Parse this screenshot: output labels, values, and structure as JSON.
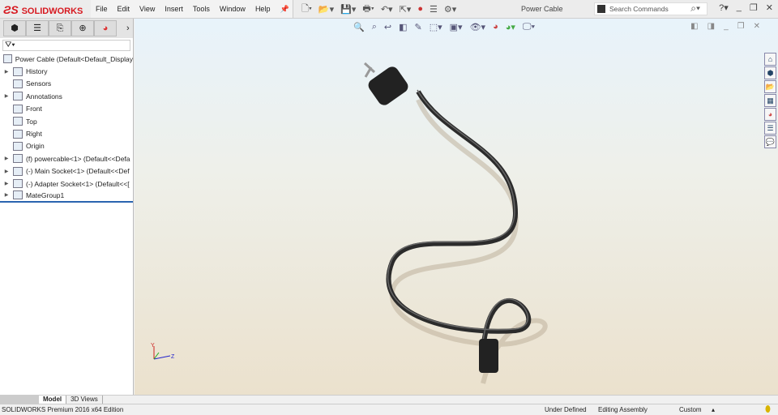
{
  "app": {
    "logo": "SOLIDWORKS",
    "title": "Power Cable"
  },
  "menu": [
    "File",
    "Edit",
    "View",
    "Insert",
    "Tools",
    "Window",
    "Help"
  ],
  "search": {
    "placeholder": "Search Commands"
  },
  "tree": {
    "root": "Power Cable  (Default<Default_Display",
    "items": [
      {
        "label": "History",
        "arrow": true,
        "icon": "history-folder-icon"
      },
      {
        "label": "Sensors",
        "arrow": false,
        "icon": "sensors-folder-icon"
      },
      {
        "label": "Annotations",
        "arrow": true,
        "icon": "annotations-folder-icon"
      },
      {
        "label": "Front",
        "arrow": false,
        "icon": "plane-icon"
      },
      {
        "label": "Top",
        "arrow": false,
        "icon": "plane-icon"
      },
      {
        "label": "Right",
        "arrow": false,
        "icon": "plane-icon"
      },
      {
        "label": "Origin",
        "arrow": false,
        "icon": "origin-icon"
      },
      {
        "label": "(f) powercable<1> (Default<<Defa",
        "arrow": true,
        "icon": "part-icon"
      },
      {
        "label": "(-) Main Socket<1> (Default<<Def",
        "arrow": true,
        "icon": "part-icon"
      },
      {
        "label": "(-) Adapter Socket<1> (Default<<[",
        "arrow": true,
        "icon": "part-icon"
      },
      {
        "label": "MateGroup1",
        "arrow": true,
        "icon": "mates-icon"
      }
    ]
  },
  "bottom_tabs": [
    "Model",
    "3D Views"
  ],
  "status": {
    "edition": "SOLIDWORKS Premium 2016 x64 Edition",
    "state": "Under Defined",
    "mode": "Editing Assembly",
    "units": "Custom"
  }
}
